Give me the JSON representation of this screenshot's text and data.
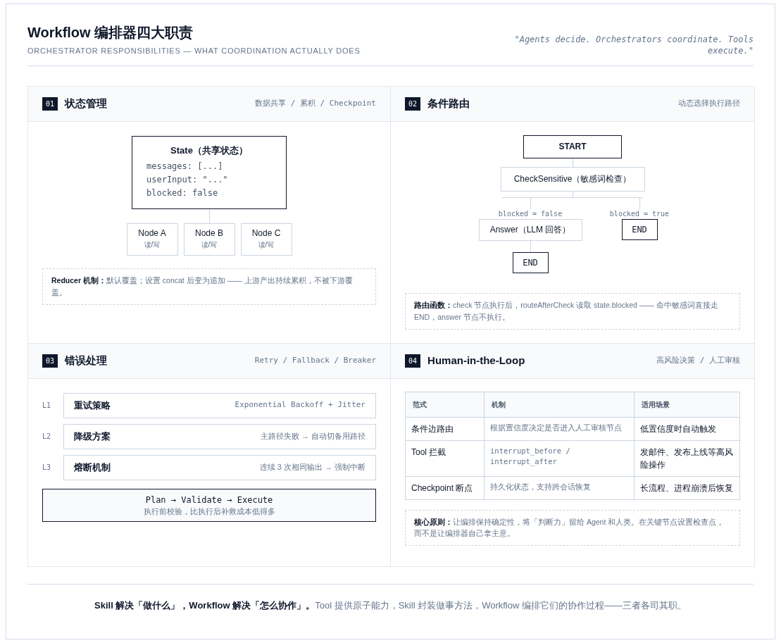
{
  "header": {
    "title": "Workflow 编排器四大职责",
    "subtitle": "ORCHESTRATOR RESPONSIBILITIES — WHAT COORDINATION ACTUALLY DOES",
    "quote": "\"Agents decide. Orchestrators coordinate. Tools execute.\""
  },
  "panels": [
    {
      "kind": "state",
      "number": "01",
      "title": "状态管理",
      "tags": "数据共享 / 累积 / Checkpoint",
      "state_box": {
        "title": "State（共享状态）",
        "lines": [
          "messages: [...]",
          "userInput: \"...\"",
          "blocked: false"
        ]
      },
      "nodes": [
        {
          "name": "Node A",
          "access": "读/写"
        },
        {
          "name": "Node B",
          "access": "读/写"
        },
        {
          "name": "Node C",
          "access": "读/写"
        }
      ],
      "note": "**Reducer 机制：**默认覆盖；设置 concat 后变为追加 —— 上游产出持续累积，不被下游覆盖。"
    },
    {
      "kind": "routing",
      "number": "02",
      "title": "条件路由",
      "tags": "动态选择执行路径",
      "start": "START",
      "check": "CheckSensitive（敏感词检查）",
      "branches": [
        {
          "condition": "blocked = false",
          "node": "Answer（LLM 回答）",
          "end": "END"
        },
        {
          "condition": "blocked = true",
          "end": "END"
        }
      ],
      "note": "**路由函数：**check 节点执行后，routeAfterCheck 读取 state.blocked —— 命中敏感词直接走 END，answer 节点不执行。"
    },
    {
      "kind": "errors",
      "number": "03",
      "title": "错误处理",
      "tags": "Retry / Fallback / Breaker",
      "levels": [
        {
          "label": "L1",
          "name": "重试策略",
          "detail": "Exponential Backoff + Jitter",
          "kind": "code"
        },
        {
          "label": "L2",
          "name": "降级方案",
          "detail": "主路径失败 → 自动切备用路径",
          "kind": "text"
        },
        {
          "label": "L3",
          "name": "熔断机制",
          "detail": "连续 3 次相同输出 → 强制中断",
          "kind": "text"
        }
      ],
      "callout": {
        "title": "Plan → Validate → Execute",
        "text": "执行前校验，比执行后补救成本低得多"
      }
    },
    {
      "kind": "hitl",
      "number": "04",
      "title": "Human-in-the-Loop",
      "tags": "高风险决策 / 人工审核",
      "table": {
        "columns": [
          "范式",
          "机制",
          "适用场景"
        ],
        "rows": [
          {
            "paradigm": "条件边路由",
            "mechanism": "根据置信度决定是否进入人工审核节点",
            "scenario": "低置信度时自动触发",
            "kind": "text"
          },
          {
            "paradigm": "Tool 拦截",
            "mechanism": "interrupt_before / interrupt_after",
            "scenario": "发邮件、发布上线等高风险操作",
            "kind": "code"
          },
          {
            "paradigm": "Checkpoint 断点",
            "mechanism": "持久化状态，支持跨会话恢复",
            "scenario": "长流程、进程崩溃后恢复",
            "kind": "text"
          }
        ]
      },
      "note": "**核心原则：**让编排保持确定性，将「判断力」留给 Agent 和人类。在关键节点设置检查点，而不是让编排器自己拿主意。"
    }
  ],
  "footer": "**Skill 解决「做什么」，Workflow 解决「怎么协作」。**Tool 提供原子能力，Skill 封装做事方法，Workflow 编排它们的协作过程——三者各司其职。"
}
